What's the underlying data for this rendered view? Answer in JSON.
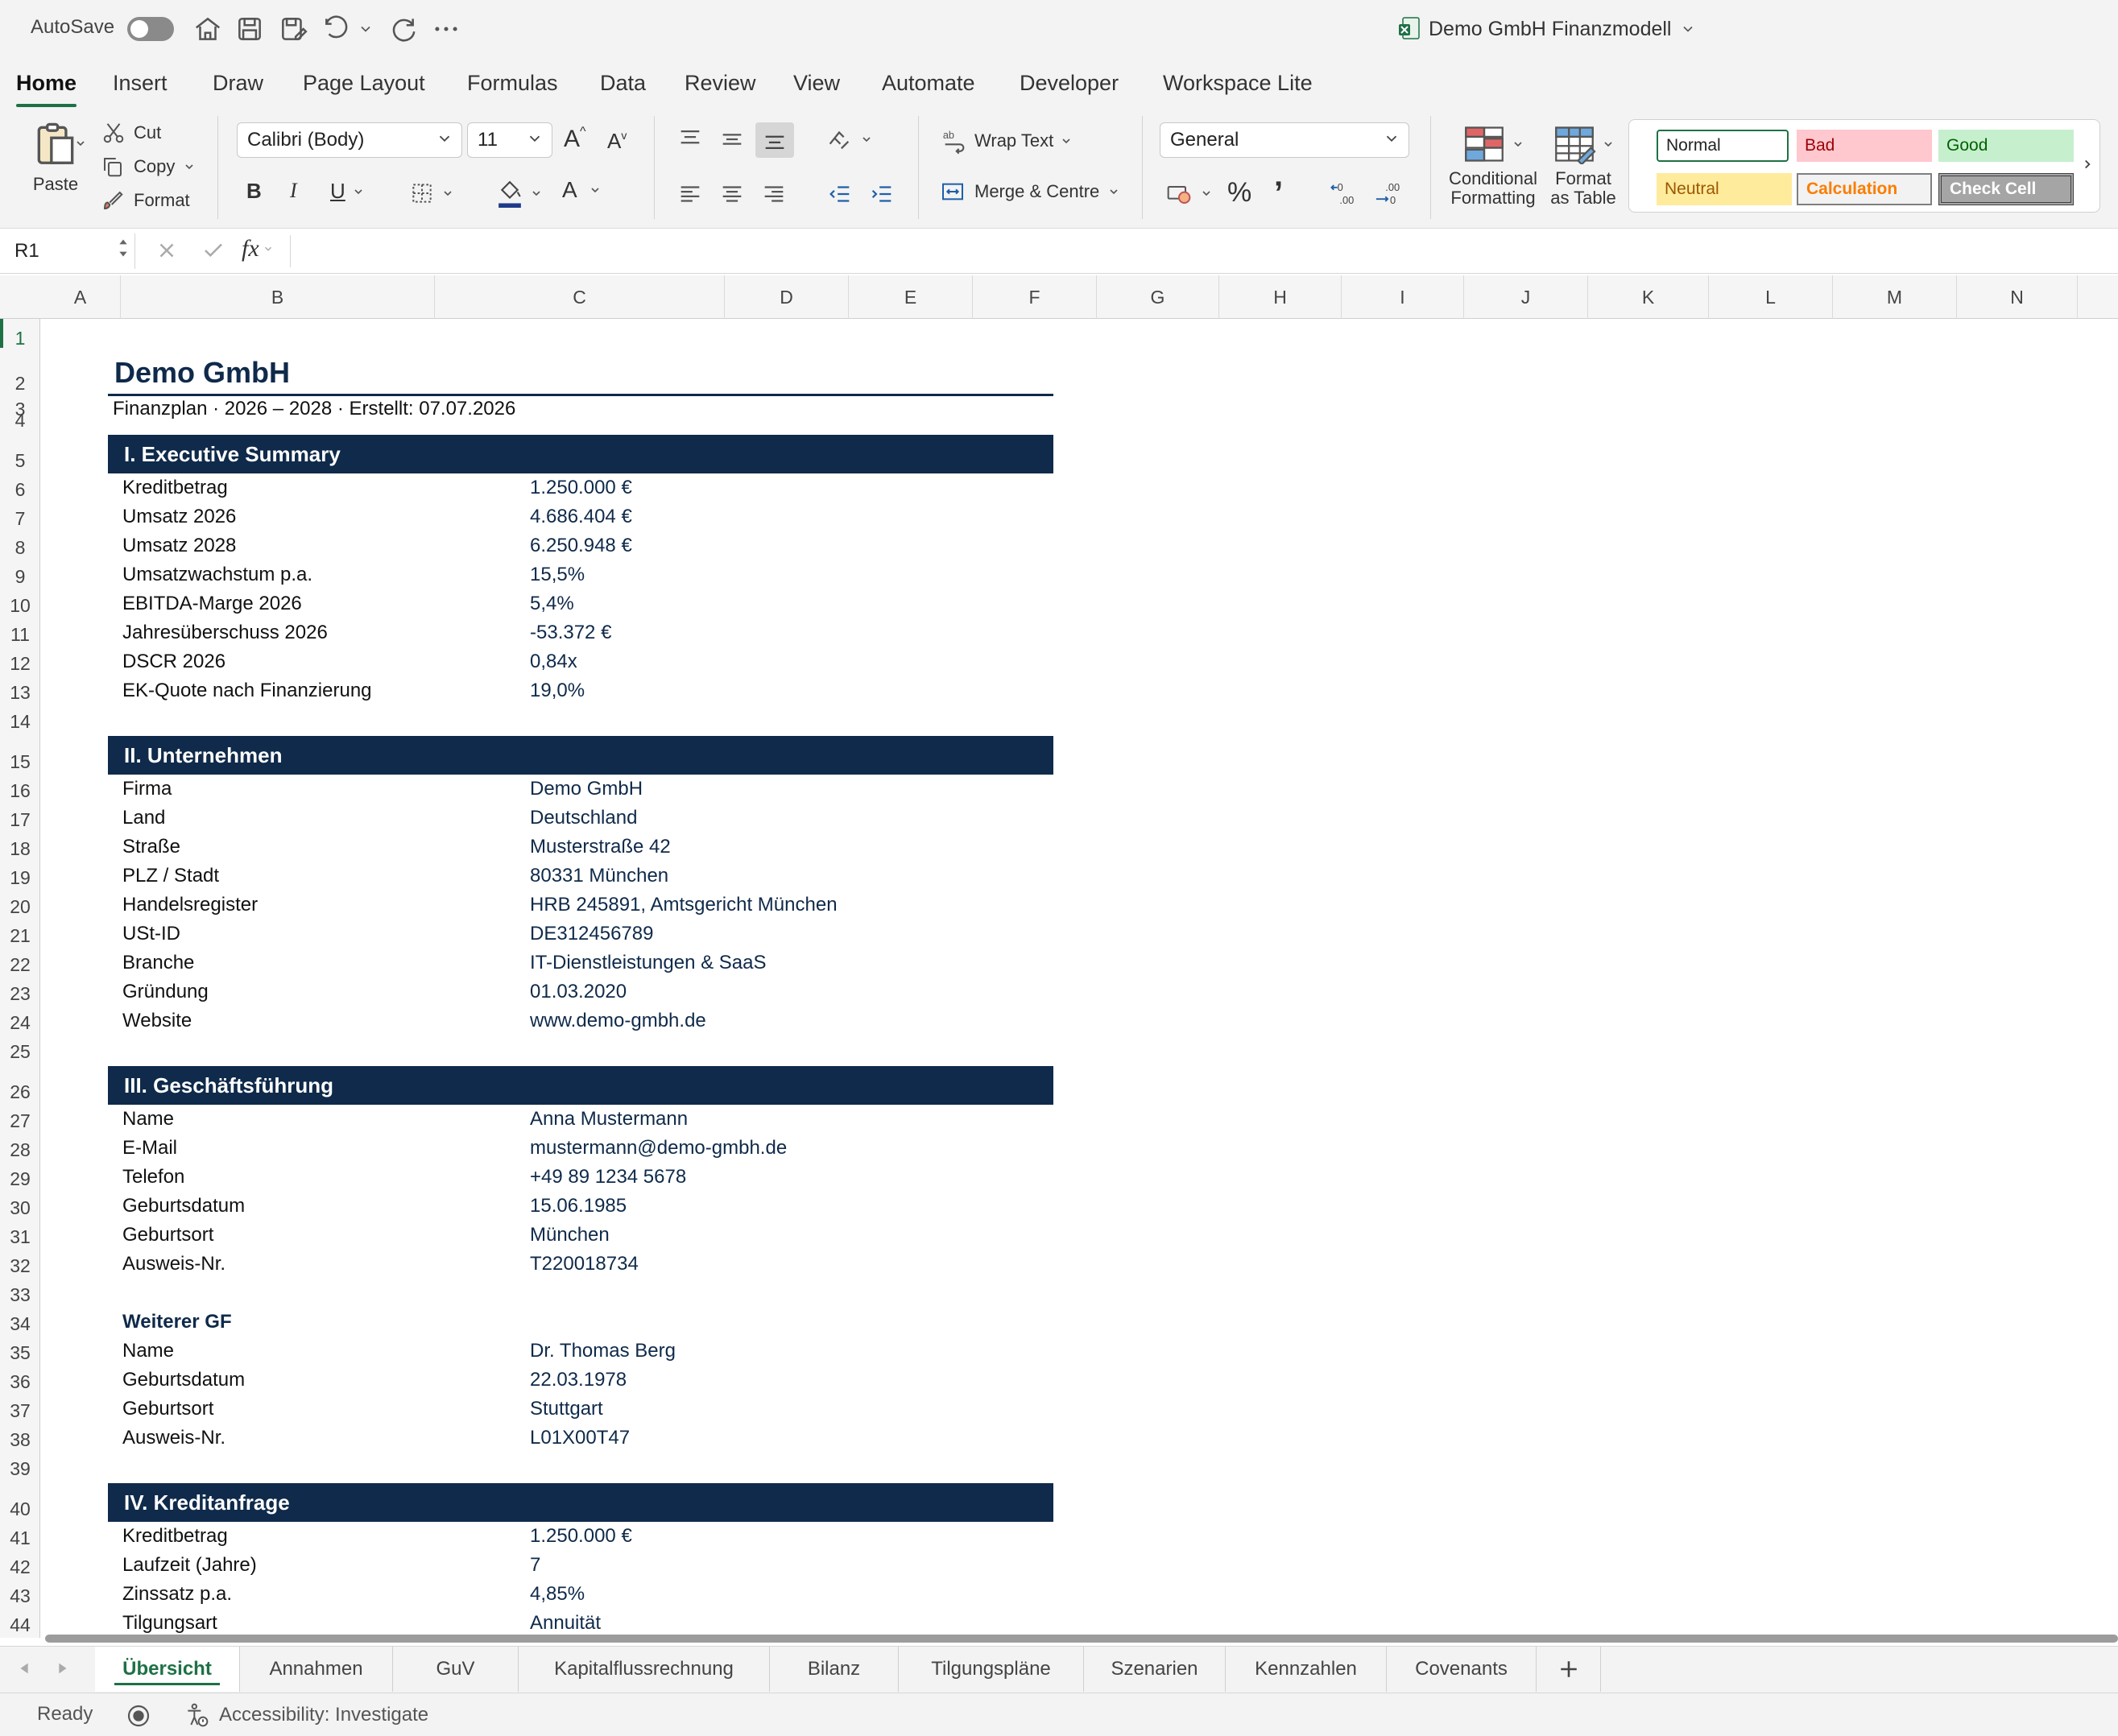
{
  "titlebar": {
    "autosave_label": "AutoSave",
    "document_title": "Demo GmbH Finanzmodell"
  },
  "ribbon_tabs": [
    "Home",
    "Insert",
    "Draw",
    "Page Layout",
    "Formulas",
    "Data",
    "Review",
    "View",
    "Automate",
    "Developer",
    "Workspace Lite"
  ],
  "ribbon": {
    "paste": "Paste",
    "cut": "Cut",
    "copy": "Copy",
    "format": "Format",
    "font_name": "Calibri (Body)",
    "font_size": "11",
    "bold": "B",
    "italic": "I",
    "underline": "U",
    "font_color_glyph": "A",
    "grow_font": "A",
    "shrink_font": "A",
    "wrap_text": "Wrap Text",
    "merge_centre": "Merge & Centre",
    "number_format": "General",
    "percent": "%",
    "comma": "’",
    "conditional_formatting_1": "Conditional",
    "conditional_formatting_2": "Formatting",
    "format_table_1": "Format",
    "format_table_2": "as Table",
    "styles": {
      "normal": "Normal",
      "bad": "Bad",
      "good": "Good",
      "neutral": "Neutral",
      "calculation": "Calculation",
      "check_cell": "Check Cell"
    },
    "colors": {
      "accent_green": "#1e7145",
      "bad_bg": "#ffc7ce",
      "bad_fg": "#9c0006",
      "good_bg": "#c6efce",
      "good_fg": "#006100",
      "neutral_bg": "#ffeb9c",
      "neutral_fg": "#9c5700",
      "calc_fg": "#fa7d00",
      "check_bg": "#a5a5a5"
    }
  },
  "formula_bar": {
    "name_box": "R1",
    "fx": "fx",
    "formula": ""
  },
  "columns": [
    "A",
    "B",
    "C",
    "D",
    "E",
    "F",
    "G",
    "H",
    "I",
    "J",
    "K",
    "L",
    "M",
    "N"
  ],
  "row_numbers": [
    "1",
    "2",
    "3",
    "4",
    "5",
    "6",
    "7",
    "8",
    "9",
    "10",
    "11",
    "12",
    "13",
    "14",
    "15",
    "16",
    "17",
    "18",
    "19",
    "20",
    "21",
    "22",
    "23",
    "24",
    "25",
    "26",
    "27",
    "28",
    "29",
    "30",
    "31",
    "32",
    "33",
    "34",
    "35",
    "36",
    "37",
    "38",
    "39",
    "40",
    "41",
    "42",
    "43",
    "44"
  ],
  "sheet": {
    "title": "Demo GmbH",
    "subtitle": "Finanzplan  ·  2026 – 2028  ·  Erstellt: 07.07.2026",
    "header_color": "#0f2a4a",
    "sections": [
      {
        "heading": "I. Executive Summary",
        "rows": [
          {
            "label": "Kreditbetrag",
            "value": "1.250.000 €"
          },
          {
            "label": "Umsatz 2026",
            "value": "4.686.404 €"
          },
          {
            "label": "Umsatz 2028",
            "value": "6.250.948 €"
          },
          {
            "label": "Umsatzwachstum p.a.",
            "value": "15,5%"
          },
          {
            "label": "EBITDA-Marge 2026",
            "value": "5,4%"
          },
          {
            "label": "Jahresüberschuss 2026",
            "value": "-53.372 €"
          },
          {
            "label": "DSCR 2026",
            "value": "0,84x"
          },
          {
            "label": "EK-Quote nach Finanzierung",
            "value": "19,0%"
          }
        ]
      },
      {
        "heading": "II. Unternehmen",
        "rows": [
          {
            "label": "Firma",
            "value": "Demo GmbH"
          },
          {
            "label": "Land",
            "value": "Deutschland"
          },
          {
            "label": "Straße",
            "value": "Musterstraße 42"
          },
          {
            "label": "PLZ / Stadt",
            "value": "80331 München"
          },
          {
            "label": "Handelsregister",
            "value": "HRB 245891, Amtsgericht München"
          },
          {
            "label": "USt-ID",
            "value": "DE312456789"
          },
          {
            "label": "Branche",
            "value": "IT-Dienstleistungen & SaaS"
          },
          {
            "label": "Gründung",
            "value": "01.03.2020"
          },
          {
            "label": "Website",
            "value": "www.demo-gmbh.de"
          }
        ]
      },
      {
        "heading": "III. Geschäftsführung",
        "rows": [
          {
            "label": "Name",
            "value": "Anna Mustermann"
          },
          {
            "label": "E-Mail",
            "value": "mustermann@demo-gmbh.de"
          },
          {
            "label": "Telefon",
            "value": "+49 89 1234 5678"
          },
          {
            "label": "Geburtsdatum",
            "value": "15.06.1985"
          },
          {
            "label": "Geburtsort",
            "value": "München"
          },
          {
            "label": "Ausweis-Nr.",
            "value": "T220018734"
          }
        ],
        "sub_heading": "Weiterer GF",
        "sub_rows": [
          {
            "label": "Name",
            "value": "Dr. Thomas Berg"
          },
          {
            "label": "Geburtsdatum",
            "value": "22.03.1978"
          },
          {
            "label": "Geburtsort",
            "value": "Stuttgart"
          },
          {
            "label": "Ausweis-Nr.",
            "value": "L01X00T47"
          }
        ]
      },
      {
        "heading": "IV. Kreditanfrage",
        "rows": [
          {
            "label": "Kreditbetrag",
            "value": "1.250.000 €"
          },
          {
            "label": "Laufzeit (Jahre)",
            "value": "7"
          },
          {
            "label": "Zinssatz p.a.",
            "value": "4,85%"
          },
          {
            "label": "Tilgungsart",
            "value": "Annuität"
          }
        ]
      }
    ]
  },
  "sheet_tabs": [
    "Übersicht",
    "Annahmen",
    "GuV",
    "Kapitalflussrechnung",
    "Bilanz",
    "Tilgungspläne",
    "Szenarien",
    "Kennzahlen",
    "Covenants"
  ],
  "status": {
    "ready": "Ready",
    "accessibility": "Accessibility: Investigate"
  }
}
